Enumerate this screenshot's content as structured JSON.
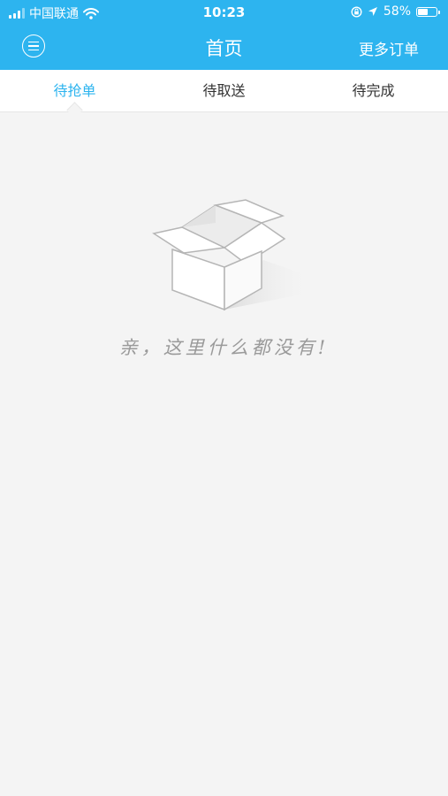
{
  "status_bar": {
    "carrier": "中国联通",
    "time": "10:23",
    "battery_percent": "58%",
    "battery_level": 0.58,
    "icons": [
      "signal-icon",
      "wifi-icon",
      "orientation-lock-icon",
      "location-icon",
      "battery-icon"
    ]
  },
  "navbar": {
    "title": "首页",
    "more_orders": "更多订单",
    "menu_icon": "menu-icon"
  },
  "tabs": [
    {
      "label": "待抢单",
      "active": true
    },
    {
      "label": "待取送",
      "active": false
    },
    {
      "label": "待完成",
      "active": false
    }
  ],
  "empty_state": {
    "message": "亲，这里什么都没有!",
    "icon": "empty-box-icon"
  },
  "colors": {
    "primary": "#2db4ef",
    "background": "#f4f4f4",
    "tab_text": "#333333",
    "empty_text": "#9a9a9a"
  }
}
